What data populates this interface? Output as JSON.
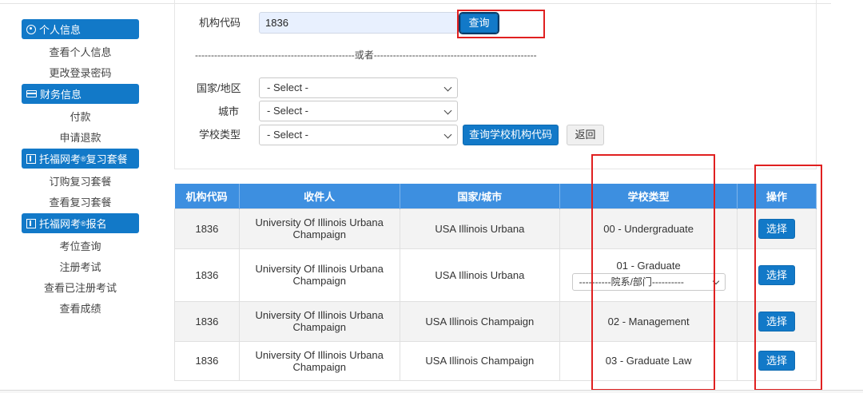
{
  "sidebar": {
    "personal_header": "个人信息",
    "view_personal": "查看个人信息",
    "change_password": "更改登录密码",
    "finance_header": "财务信息",
    "payment": "付款",
    "refund": "申请退款",
    "prep_header": "托福网考",
    "prep_header_suffix": "复习套餐",
    "buy_prep": "订购复习套餐",
    "view_prep": "查看复习套餐",
    "register_header": "托福网考",
    "register_header_suffix": "报名",
    "seat_search": "考位查询",
    "register_exam": "注册考试",
    "view_registered": "查看已注册考试",
    "view_scores": "查看成绩",
    "registered_mark": "®"
  },
  "search": {
    "code_label": "机构代码",
    "code_value": "1836",
    "query_button": "查询",
    "divider": "--------------------------------------------------或者---------------------------------------------------",
    "country_label": "国家/地区",
    "city_label": "城市",
    "school_type_label": "学校类型",
    "country_value": "- Select -",
    "city_value": "- Select -",
    "school_type_value": "- Select -",
    "lookup_button": "查询学校机构代码",
    "back_button": "返回"
  },
  "table": {
    "headers": [
      "机构代码",
      "收件人",
      "国家/城市",
      "学校类型",
      "操作"
    ],
    "rows": [
      {
        "code": "1836",
        "recipient": "University Of Illinois Urbana Champaign",
        "location": "USA Illinois Urbana",
        "type": "00 - Undergraduate",
        "action": "选择"
      },
      {
        "code": "1836",
        "recipient": "University Of Illinois Urbana Champaign",
        "location": "USA Illinois Urbana",
        "type": "01 - Graduate",
        "dept": "----------院系/部门----------",
        "action": "选择"
      },
      {
        "code": "1836",
        "recipient": "University Of Illinois Urbana Champaign",
        "location": "USA Illinois Champaign",
        "type": "02 - Management",
        "action": "选择"
      },
      {
        "code": "1836",
        "recipient": "University Of Illinois Urbana Champaign",
        "location": "USA Illinois Champaign",
        "type": "03 - Graduate Law",
        "action": "选择"
      }
    ]
  },
  "colors": {
    "primary": "#1279c8",
    "table_header": "#3d8fe0",
    "highlight": "#e02020"
  }
}
